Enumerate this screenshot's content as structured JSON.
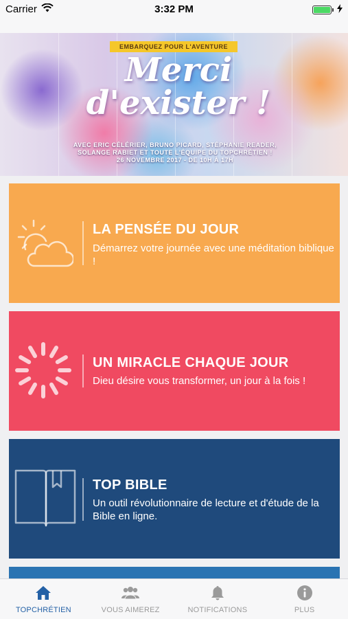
{
  "status_bar": {
    "carrier": "Carrier",
    "time": "3:32 PM",
    "battery_level": 1.0,
    "icons": [
      "wifi-icon",
      "battery-icon",
      "charging-icon"
    ]
  },
  "banner": {
    "tagline": "EMBARQUEZ POUR L'AVENTURE",
    "title_line1": "Merci",
    "title_line2": "d'exister !",
    "subtitle_line1": "AVEC ERIC CÉLÉRIER, BRUNO PICARD, STÉPHANIE READER,",
    "subtitle_line2": "SOLANGE RABIET ET TOUTE L'ÉQUIPE DU TOPCHRÉTIEN !",
    "subtitle_line3": "26 NOVEMBRE 2017 - DE 10H À 17H"
  },
  "cards": [
    {
      "title": "LA PENSÉE DU JOUR",
      "description": "Démarrez votre journée avec une méditation biblique !",
      "icon": "sun-cloud-icon",
      "color": "#f8a94f"
    },
    {
      "title": "UN MIRACLE CHAQUE JOUR",
      "description": "Dieu désire vous transformer, un jour à la fois !",
      "icon": "spinner-icon",
      "color": "#f04a61"
    },
    {
      "title": "TOP BIBLE",
      "description": "Un outil révolutionnaire de lecture et d'étude de la Bible en ligne.",
      "icon": "book-icon",
      "color": "#1f4a7c"
    },
    {
      "color": "#2a73b2"
    }
  ],
  "tab_bar": {
    "active_color": "#2461a6",
    "inactive_color": "#9a9a9a",
    "tabs": [
      {
        "label": "TOPCHRÉTIEN",
        "icon": "home-icon",
        "active": true
      },
      {
        "label": "VOUS AIMEREZ",
        "icon": "people-icon",
        "active": false
      },
      {
        "label": "NOTIFICATIONS",
        "icon": "bell-icon",
        "active": false
      },
      {
        "label": "PLUS",
        "icon": "info-icon",
        "active": false
      }
    ]
  }
}
